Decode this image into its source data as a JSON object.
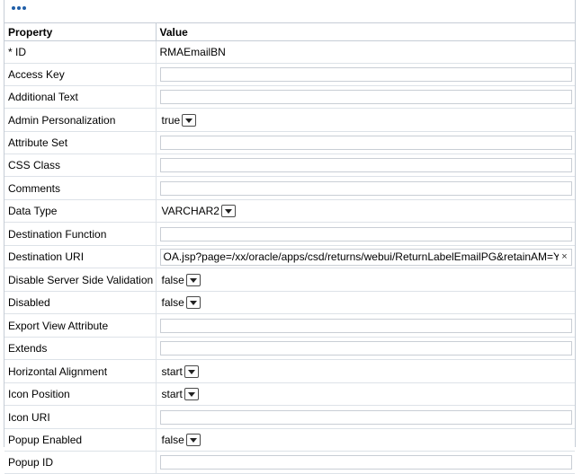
{
  "toolbar": {
    "more_icon": "more-dots-icon"
  },
  "table": {
    "headers": {
      "property": "Property",
      "value": "Value"
    },
    "rows": [
      {
        "label": "* ID",
        "kind": "text",
        "value": "RMAEmailBN"
      },
      {
        "label": "Access Key",
        "kind": "input",
        "value": ""
      },
      {
        "label": "Additional Text",
        "kind": "input",
        "value": ""
      },
      {
        "label": "Admin Personalization",
        "kind": "select",
        "value": "true"
      },
      {
        "label": "Attribute Set",
        "kind": "input",
        "value": ""
      },
      {
        "label": "CSS Class",
        "kind": "input",
        "value": ""
      },
      {
        "label": "Comments",
        "kind": "input",
        "value": ""
      },
      {
        "label": "Data Type",
        "kind": "select",
        "value": "VARCHAR2"
      },
      {
        "label": "Destination Function",
        "kind": "input",
        "value": ""
      },
      {
        "label": "Destination URI",
        "kind": "uri",
        "value": "OA.jsp?page=/xx/oracle/apps/csd/returns/webui/ReturnLabelEmailPG&retainAM=Y"
      },
      {
        "label": "Disable Server Side Validation",
        "kind": "select",
        "value": "false"
      },
      {
        "label": "Disabled",
        "kind": "select",
        "value": "false"
      },
      {
        "label": "Export View Attribute",
        "kind": "input",
        "value": ""
      },
      {
        "label": "Extends",
        "kind": "input",
        "value": ""
      },
      {
        "label": "Horizontal Alignment",
        "kind": "select",
        "value": "start"
      },
      {
        "label": "Icon Position",
        "kind": "select",
        "value": "start"
      },
      {
        "label": "Icon URI",
        "kind": "input",
        "value": ""
      },
      {
        "label": "Popup Enabled",
        "kind": "select",
        "value": "false"
      },
      {
        "label": "Popup ID",
        "kind": "input",
        "value": ""
      }
    ]
  },
  "colors": {
    "border": "#c6cdd6",
    "accent": "#1f5ea8"
  }
}
